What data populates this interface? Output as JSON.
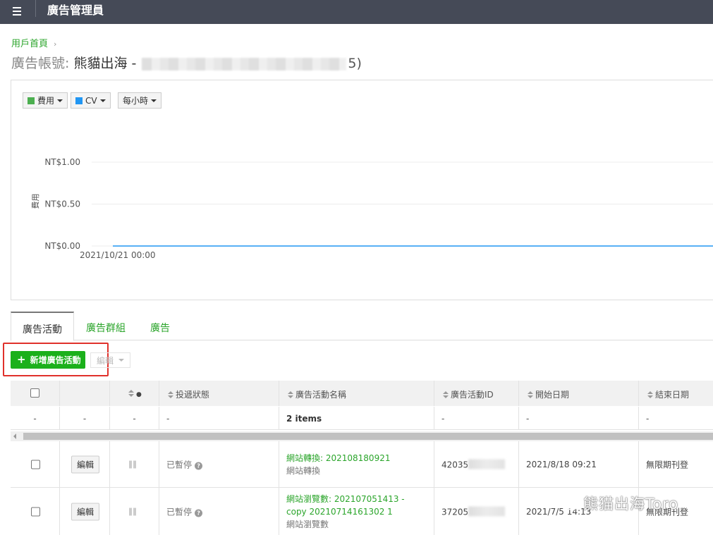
{
  "topbar": {
    "title": "廣告管理員"
  },
  "breadcrumb": {
    "home": "用戶首頁",
    "separator": "›"
  },
  "account": {
    "label": "廣告帳號:",
    "name": "熊貓出海 - ",
    "suffix": "5)"
  },
  "chart_controls": {
    "metric1": {
      "label": "費用",
      "color": "#4caf50"
    },
    "metric2": {
      "label": "CV",
      "color": "#2196f3"
    },
    "interval": {
      "label": "每小時"
    }
  },
  "chart_data": {
    "type": "line",
    "ylabel": "費用",
    "yticks": [
      "NT$1.00",
      "NT$0.50",
      "NT$0.00"
    ],
    "ylim": [
      0,
      1
    ],
    "x": [
      "2021/10/21 00:00"
    ],
    "series": [
      {
        "values": [
          0,
          0
        ],
        "color": "#2196f3"
      }
    ]
  },
  "tabs": [
    {
      "label": "廣告活動",
      "active": true
    },
    {
      "label": "廣告群組",
      "active": false
    },
    {
      "label": "廣告",
      "active": false
    }
  ],
  "toolbar": {
    "add_label": "新增廣告活動",
    "edit_label": "編輯"
  },
  "table": {
    "headers": [
      "",
      "",
      "●",
      "投遞狀態",
      "廣告活動名稱",
      "廣告活動ID",
      "開始日期",
      "結束日期"
    ],
    "summary": [
      "-",
      "-",
      "-",
      "-",
      "2 items",
      "-",
      "-",
      "-"
    ],
    "rows": [
      {
        "edit": "編輯",
        "status": "已暫停",
        "name_link": "網站轉換: 202108180921",
        "name_sub": "網站轉換",
        "id": "42035",
        "start": "2021/8/18 09:21",
        "end": "無限期刊登"
      },
      {
        "edit": "編輯",
        "status": "已暫停",
        "name_link": "網站瀏覽數: 202107051413 - copy 20210714161302 1",
        "name_sub": "網站瀏覽數",
        "id": "37205",
        "start": "2021/7/5 14:13",
        "end": "無限期刊登"
      }
    ]
  },
  "watermark": {
    "text": "熊猫出海Toro"
  }
}
